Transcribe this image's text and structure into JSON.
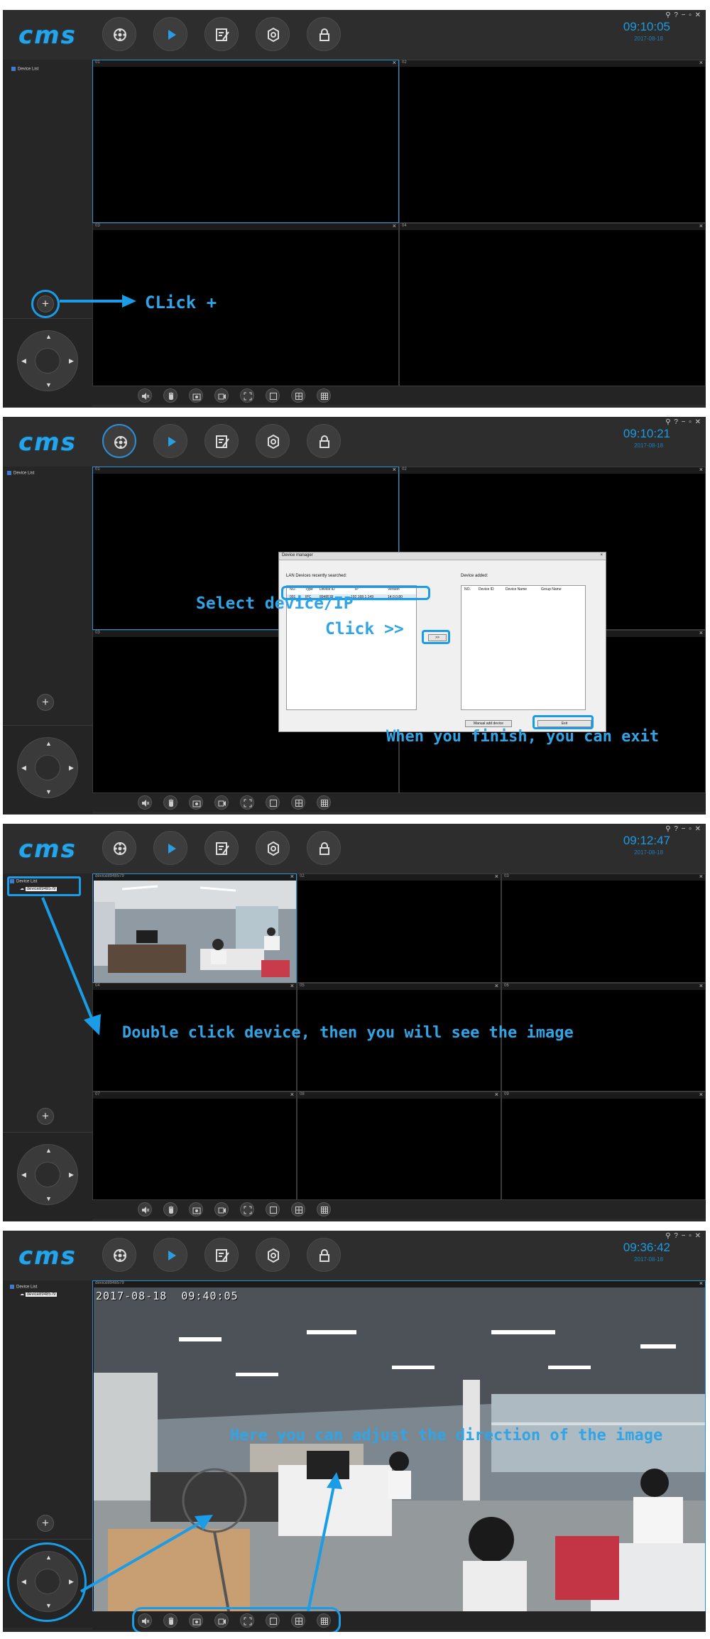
{
  "app": {
    "logo": "cms",
    "window_controls": "⚲ ? − ▫ ✕",
    "toolbar": [
      "device-manager-icon",
      "playback-icon",
      "config-icon",
      "settings-icon",
      "lock-icon"
    ],
    "bottom_tools": [
      "mute-icon",
      "hand-icon",
      "snapshot-icon",
      "record-icon",
      "fullscreen-icon",
      "single-view-icon",
      "quad-view-icon",
      "nine-view-icon"
    ],
    "date": "2017-08-18",
    "plus": "+",
    "close": "×",
    "ptz_arrows": {
      "up": "▲",
      "down": "▼",
      "left": "◀",
      "right": "▶"
    }
  },
  "panels": [
    {
      "clock": "09:10:05",
      "device_list_label": "Device List",
      "cells": [
        "01",
        "02",
        "03",
        "04"
      ],
      "annotation": "CLick +"
    },
    {
      "clock": "09:10:21",
      "device_list_label": "Device List",
      "cells": [
        "01",
        "02",
        "03",
        "04"
      ],
      "dialog": {
        "title": "Device manager",
        "close": "×",
        "left_label": "LAN Devices recently searched:",
        "left_headers": [
          "NO.",
          "Type",
          "Device ID",
          "IP",
          "Version"
        ],
        "left_row": [
          "001",
          "IPC",
          "8948579",
          "192.168.1.149",
          "14.0.0.80"
        ],
        "right_label": "Device added:",
        "right_headers": [
          "NO.",
          "Device ID",
          "Device Name",
          "Group Name"
        ],
        "move_button": ">>",
        "manual_button": "Manual add device",
        "exit_button": "Exit"
      },
      "annotations": {
        "select": "Select device/IP",
        "click": "Click >>",
        "finish": "When you finish, you can exit"
      }
    },
    {
      "clock": "09:12:47",
      "device_list_label": "Device List",
      "device_name": "device8948579",
      "cells": [
        "device8948579",
        "02",
        "03",
        "04",
        "05",
        "06",
        "07",
        "08",
        "09"
      ],
      "annotation": "Double click device, then you will see the image"
    },
    {
      "clock": "09:36:42",
      "device_list_label": "Device List",
      "device_name": "device8948579",
      "cells": [
        "device8948579"
      ],
      "osd": "2017-08-18  09:40:05",
      "annotation": "Here you can adjust the direction of the image"
    }
  ]
}
